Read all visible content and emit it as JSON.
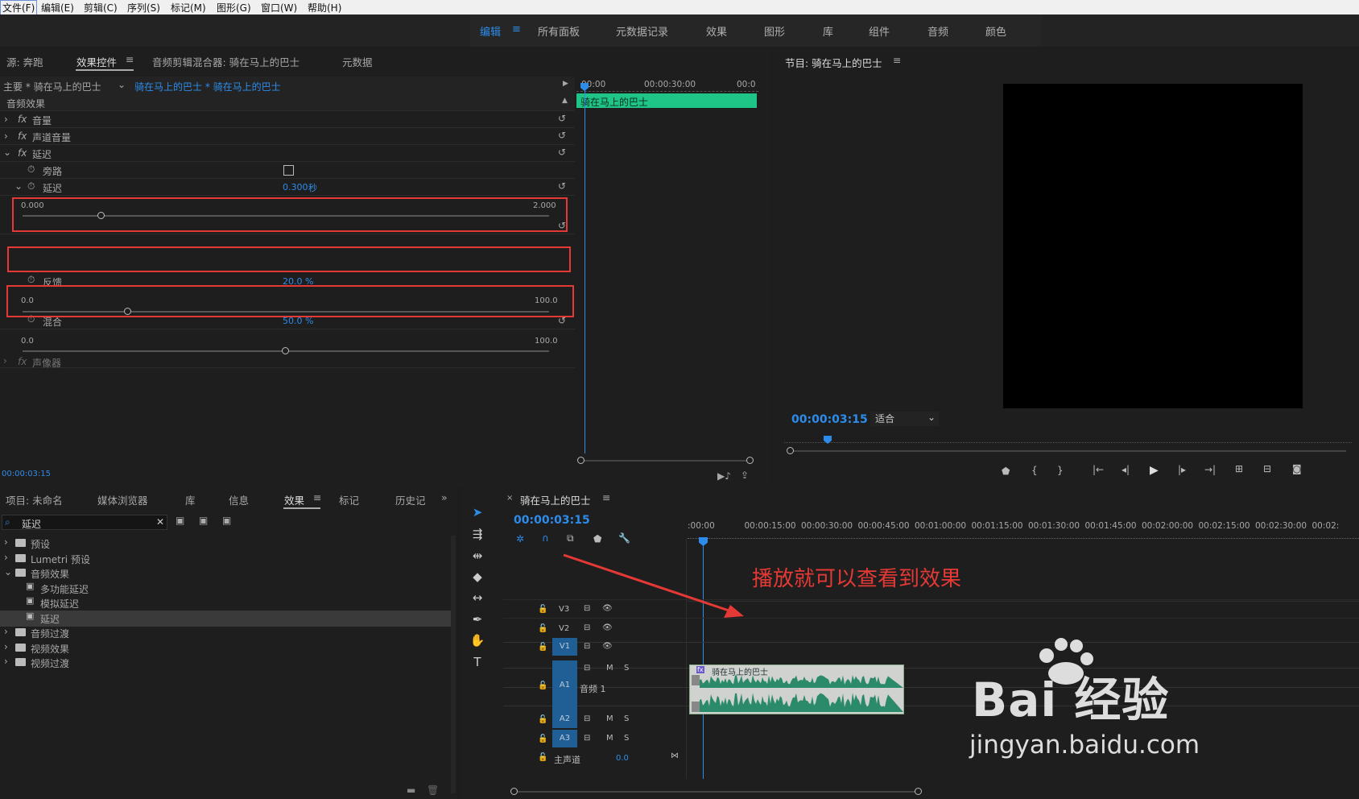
{
  "menu": [
    "文件(F)",
    "编辑(E)",
    "剪辑(C)",
    "序列(S)",
    "标记(M)",
    "图形(G)",
    "窗口(W)",
    "帮助(H)"
  ],
  "workspaces": {
    "active": "编辑",
    "items": [
      "所有面板",
      "元数据记录",
      "效果",
      "图形",
      "库",
      "组件",
      "音频",
      "颜色"
    ]
  },
  "source_tabs": {
    "source": "源: 奔跑",
    "effect_controls": "效果控件",
    "audio_mixer": "音频剪辑混合器: 骑在马上的巴士",
    "metadata": "元数据"
  },
  "ec": {
    "master": "主要 * 骑在马上的巴士",
    "clip": "骑在马上的巴士 * 骑在马上的巴士",
    "ruler": {
      "t0": "00:00",
      "t1": "00:00:30:00",
      "t2": "00:0"
    },
    "clip_bar": "骑在马上的巴士",
    "section": "音频效果",
    "fx": [
      "音量",
      "声道音量",
      "延迟"
    ],
    "bypass": "旁路",
    "delay": {
      "label": "延迟",
      "value": "0.300",
      "unit": "秒",
      "min": "0.000",
      "max": "2.000",
      "level": 0.15
    },
    "feedback": {
      "label": "反馈",
      "value": "20.0 %",
      "min": "0.0",
      "max": "100.0",
      "level": 0.2
    },
    "mix": {
      "label": "混合",
      "value": "50.0 %",
      "min": "0.0",
      "max": "100.0",
      "level": 0.5
    },
    "panner": "声像器",
    "timecode": "00:00:03:15"
  },
  "program": {
    "title": "节目: 骑在马上的巴士",
    "timecode": "00:00:03:15",
    "fit": "适合"
  },
  "project": {
    "tabs": {
      "project": "项目: 未命名",
      "media": "媒体浏览器",
      "lib": "库",
      "info": "信息",
      "effects": "效果",
      "markers": "标记",
      "history": "历史记"
    },
    "search": "延迟",
    "tree": [
      {
        "label": "预设",
        "depth": 0,
        "type": "folder"
      },
      {
        "label": "Lumetri 预设",
        "depth": 0,
        "type": "folder"
      },
      {
        "label": "音频效果",
        "depth": 0,
        "type": "folder",
        "open": true
      },
      {
        "label": "多功能延迟",
        "depth": 1,
        "type": "fx"
      },
      {
        "label": "模拟延迟",
        "depth": 1,
        "type": "fx"
      },
      {
        "label": "延迟",
        "depth": 1,
        "type": "fx",
        "selected": true
      },
      {
        "label": "音频过渡",
        "depth": 0,
        "type": "folder"
      },
      {
        "label": "视频效果",
        "depth": 0,
        "type": "folder"
      },
      {
        "label": "视频过渡",
        "depth": 0,
        "type": "folder"
      }
    ]
  },
  "timeline": {
    "title": "骑在马上的巴士",
    "timecode": "00:00:03:15",
    "ruler": [
      ":00:00",
      "00:00:15:00",
      "00:00:30:00",
      "00:00:45:00",
      "00:01:00:00",
      "00:01:15:00",
      "00:01:30:00",
      "00:01:45:00",
      "00:02:00:00",
      "00:02:15:00",
      "00:02:30:00",
      "00:02:"
    ],
    "tracks": {
      "v3": "V3",
      "v2": "V2",
      "v1": "V1",
      "a1": "A1",
      "a1name": "音频 1",
      "a2": "A2",
      "a3": "A3",
      "master": "主声道",
      "master_val": "0.0",
      "m": "M",
      "s": "S"
    },
    "clip": "骑在马上的巴士",
    "annotation": "播放就可以查看到效果"
  },
  "watermark": {
    "brand": "Bai 经验",
    "url": "jingyan.baidu.com"
  },
  "colors": {
    "accent": "#2d8ceb",
    "clip_green": "#1fc587",
    "highlight_red": "#e53935",
    "track_blue": "#1f5f96"
  }
}
